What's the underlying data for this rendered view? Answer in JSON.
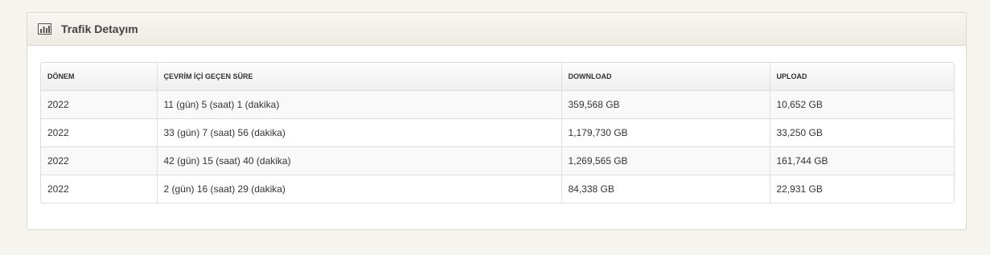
{
  "panel": {
    "title": "Trafik Detayım",
    "icon": "bar-chart-icon"
  },
  "table": {
    "headers": [
      "DÖNEM",
      "ÇEVRİM İÇİ GEÇEN SÜRE",
      "DOWNLOAD",
      "UPLOAD"
    ],
    "rows": [
      [
        "2022",
        "11 (gün) 5 (saat) 1 (dakika)",
        "359,568 GB",
        "10,652 GB"
      ],
      [
        "2022",
        "33 (gün) 7 (saat) 56 (dakika)",
        "1,179,730 GB",
        "33,250 GB"
      ],
      [
        "2022",
        "42 (gün) 15 (saat) 40 (dakika)",
        "1,269,565 GB",
        "161,744 GB"
      ],
      [
        "2022",
        "2 (gün) 16 (saat) 29 (dakika)",
        "84,338 GB",
        "22,931 GB"
      ]
    ]
  },
  "colors": {
    "page_background": "#f6f4ef",
    "header_background": "#eeebe4",
    "border": "#dddddd",
    "text": "#333333"
  }
}
